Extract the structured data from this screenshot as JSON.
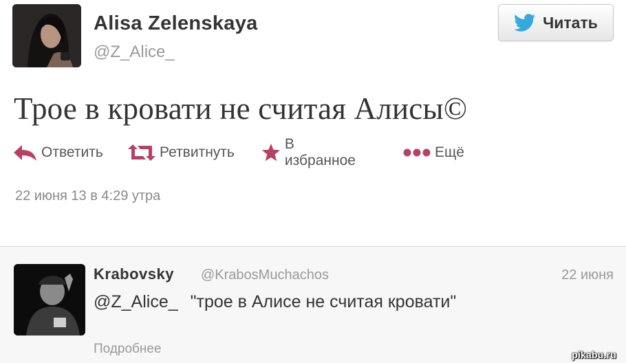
{
  "tweet": {
    "author_name": "Alisa Zelenskaya",
    "author_handle": "@Z_Alice_",
    "follow_label": "Читать",
    "text": "Трое в кровати не считая Алисы©",
    "actions": {
      "reply": "Ответить",
      "retweet": "Ретвитнуть",
      "favorite": "В избранное",
      "more": "Ещё"
    },
    "timestamp": "22 июня 13 в 4:29 утра"
  },
  "reply": {
    "author_name": "Krabovsky",
    "author_handle": "@KrabosMuchachos",
    "date": "22 июня",
    "mention": "@Z_Alice_",
    "text": "\"трое в Алисе не считая кровати\"",
    "details_label": "Подробнее"
  },
  "watermark": "pikabu.ru",
  "colors": {
    "action_icon": "#b84163",
    "twitter_bird": "#33a9dd",
    "reply_background": "#f7f7f7"
  },
  "icons": {
    "follow": "twitter-bird-icon",
    "reply": "reply-arrow-icon",
    "retweet": "retweet-icon",
    "favorite": "star-icon",
    "more": "dots-icon"
  }
}
